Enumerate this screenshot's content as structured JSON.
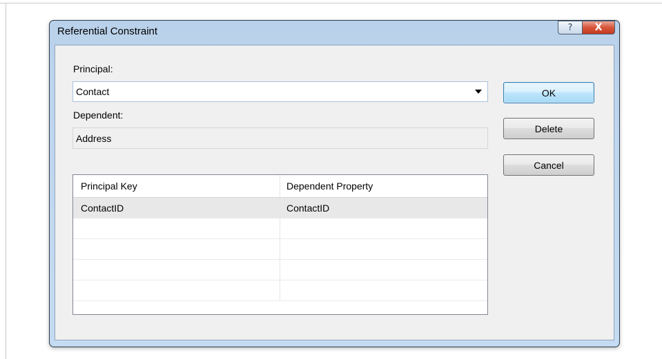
{
  "dialog": {
    "title": "Referential Constraint",
    "help_glyph": "?",
    "close_glyph": "X"
  },
  "form": {
    "principal_label": "Principal:",
    "principal_value": "Contact",
    "dependent_label": "Dependent:",
    "dependent_value": "Address"
  },
  "buttons": {
    "ok": "OK",
    "delete": "Delete",
    "cancel": "Cancel"
  },
  "grid": {
    "headers": [
      "Principal Key",
      "Dependent Property"
    ],
    "rows": [
      [
        "ContactID",
        "ContactID"
      ],
      [
        "",
        ""
      ],
      [
        "",
        ""
      ],
      [
        "",
        ""
      ],
      [
        "",
        ""
      ]
    ]
  },
  "colors": {
    "title_bar": "#b9d1ea",
    "close_button": "#c94a2e",
    "client_background": "#f0f0f0",
    "default_button": "#bee6fd"
  }
}
